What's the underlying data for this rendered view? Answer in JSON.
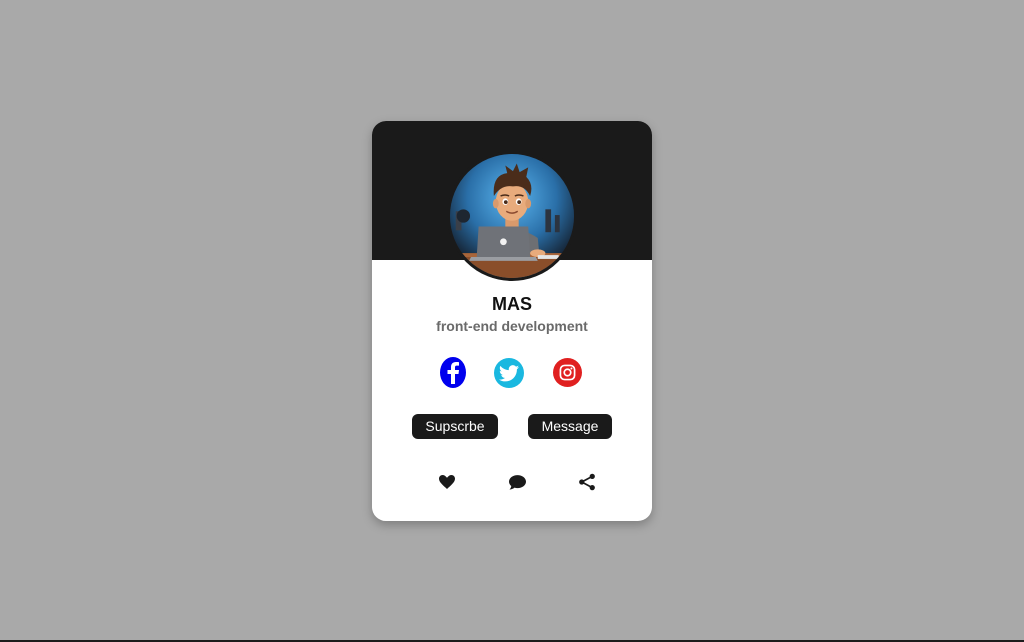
{
  "profile": {
    "name": "MAS",
    "role": "front-end development",
    "avatar_icon": "cartoon-developer-avatar"
  },
  "social": {
    "facebook": {
      "icon": "facebook-icon",
      "color": "#0000ee"
    },
    "twitter": {
      "icon": "twitter-icon",
      "color": "#1ab8e0"
    },
    "instagram": {
      "icon": "instagram-icon",
      "color": "#e02020"
    }
  },
  "buttons": {
    "subscribe_label": "Supscrbe",
    "message_label": "Message"
  },
  "actions": {
    "like_icon": "heart-icon",
    "comment_icon": "comment-icon",
    "share_icon": "share-icon"
  },
  "colors": {
    "background": "#a9a9a9",
    "header": "#1a1a1a",
    "card": "#ffffff",
    "button": "#1a1a1a"
  }
}
